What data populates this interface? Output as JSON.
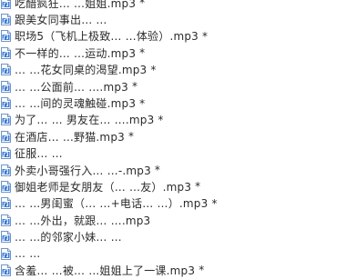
{
  "files": [
    {
      "name": "吃醋疯狂… …姐姐.mp3",
      "modified_marker": "*"
    },
    {
      "name": "跟美女同事出… …",
      "modified_marker": ""
    },
    {
      "name": "职场5（飞机上极致… …体验）.mp3",
      "modified_marker": "*"
    },
    {
      "name": "不一样的… …运动.mp3",
      "modified_marker": "*"
    },
    {
      "name": "… …花女同桌的渴望.mp3",
      "modified_marker": "*"
    },
    {
      "name": "… …公面前… ….mp3",
      "modified_marker": "*"
    },
    {
      "name": "… …间的灵魂触碰.mp3",
      "modified_marker": "*"
    },
    {
      "name": "为了… … 男友在… ….mp3",
      "modified_marker": "*"
    },
    {
      "name": "在酒店… …野猫.mp3",
      "modified_marker": "*"
    },
    {
      "name": "征服… …",
      "modified_marker": ""
    },
    {
      "name": "外卖小哥强行入… …-.mp3",
      "modified_marker": "*"
    },
    {
      "name": "御姐老师是女朋友（… …友）.mp3",
      "modified_marker": "*"
    },
    {
      "name": "… …男闺蜜（… …+电话… …）.mp3",
      "modified_marker": "*"
    },
    {
      "name": "… …外出，就跟… ….mp3",
      "modified_marker": ""
    },
    {
      "name": "… …的邻家小妹… …",
      "modified_marker": ""
    },
    {
      "name": "… …",
      "modified_marker": ""
    },
    {
      "name": "含羞… …被… …姐姐上了一课.mp3",
      "modified_marker": "*"
    }
  ],
  "icon": {
    "name": "audio-file-icon",
    "color": "#3a7bd5"
  }
}
